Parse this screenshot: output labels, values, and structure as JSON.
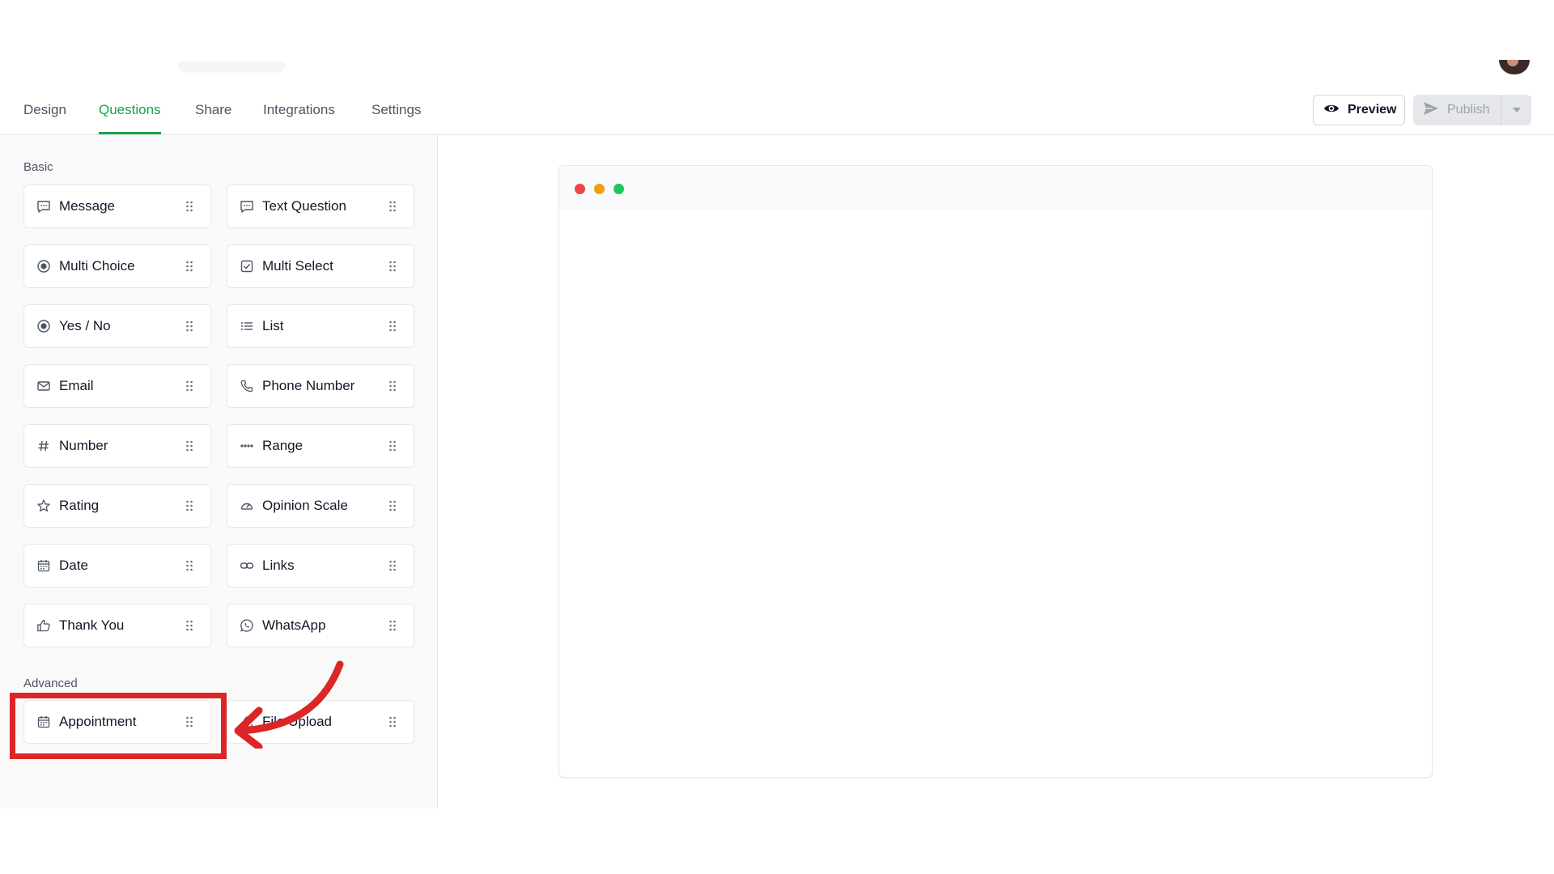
{
  "tabs": [
    {
      "label": "Design",
      "active": false
    },
    {
      "label": "Questions",
      "active": true
    },
    {
      "label": "Share",
      "active": false
    },
    {
      "label": "Integrations",
      "active": false
    },
    {
      "label": "Settings",
      "active": false
    }
  ],
  "actions": {
    "preview_label": "Preview",
    "publish_label": "Publish"
  },
  "sections": {
    "basic_label": "Basic",
    "advanced_label": "Advanced"
  },
  "basic_items": [
    {
      "label": "Message",
      "icon": "message-icon"
    },
    {
      "label": "Text Question",
      "icon": "text-question-icon"
    },
    {
      "label": "Multi Choice",
      "icon": "radio-icon"
    },
    {
      "label": "Multi Select",
      "icon": "checkbox-icon"
    },
    {
      "label": "Yes / No",
      "icon": "radio-icon"
    },
    {
      "label": "List",
      "icon": "list-icon"
    },
    {
      "label": "Email",
      "icon": "mail-icon"
    },
    {
      "label": "Phone Number",
      "icon": "phone-icon"
    },
    {
      "label": "Number",
      "icon": "hash-icon"
    },
    {
      "label": "Range",
      "icon": "range-icon"
    },
    {
      "label": "Rating",
      "icon": "star-icon"
    },
    {
      "label": "Opinion Scale",
      "icon": "gauge-icon"
    },
    {
      "label": "Date",
      "icon": "calendar-icon"
    },
    {
      "label": "Links",
      "icon": "link-icon"
    },
    {
      "label": "Thank You",
      "icon": "thumbs-up-icon"
    },
    {
      "label": "WhatsApp",
      "icon": "whatsapp-icon"
    }
  ],
  "advanced_items": [
    {
      "label": "Appointment",
      "icon": "calendar-icon"
    },
    {
      "label": "File Upload",
      "icon": "upload-icon"
    }
  ],
  "colors": {
    "accent": "#16a34a",
    "highlight": "#dc2626",
    "dot_red": "#ef4444",
    "dot_yellow": "#f59e0b",
    "dot_green": "#22c55e"
  }
}
